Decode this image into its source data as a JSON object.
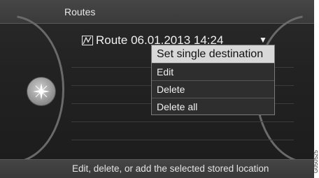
{
  "header": {
    "title": "Routes"
  },
  "route": {
    "label": "Route 06.01.2013 14:24",
    "dropdown_icon": "triangle-down-icon",
    "route_icon": "route-flag-icon"
  },
  "menu": {
    "items": [
      {
        "label": "Set single destination",
        "selected": true
      },
      {
        "label": "Edit",
        "selected": false
      },
      {
        "label": "Delete",
        "selected": false
      },
      {
        "label": "Delete all",
        "selected": false
      }
    ]
  },
  "footer": {
    "hint": "Edit, delete, or add the selected stored location"
  },
  "image_code": "G050525",
  "knob": {
    "icon": "compass-rose-icon"
  }
}
